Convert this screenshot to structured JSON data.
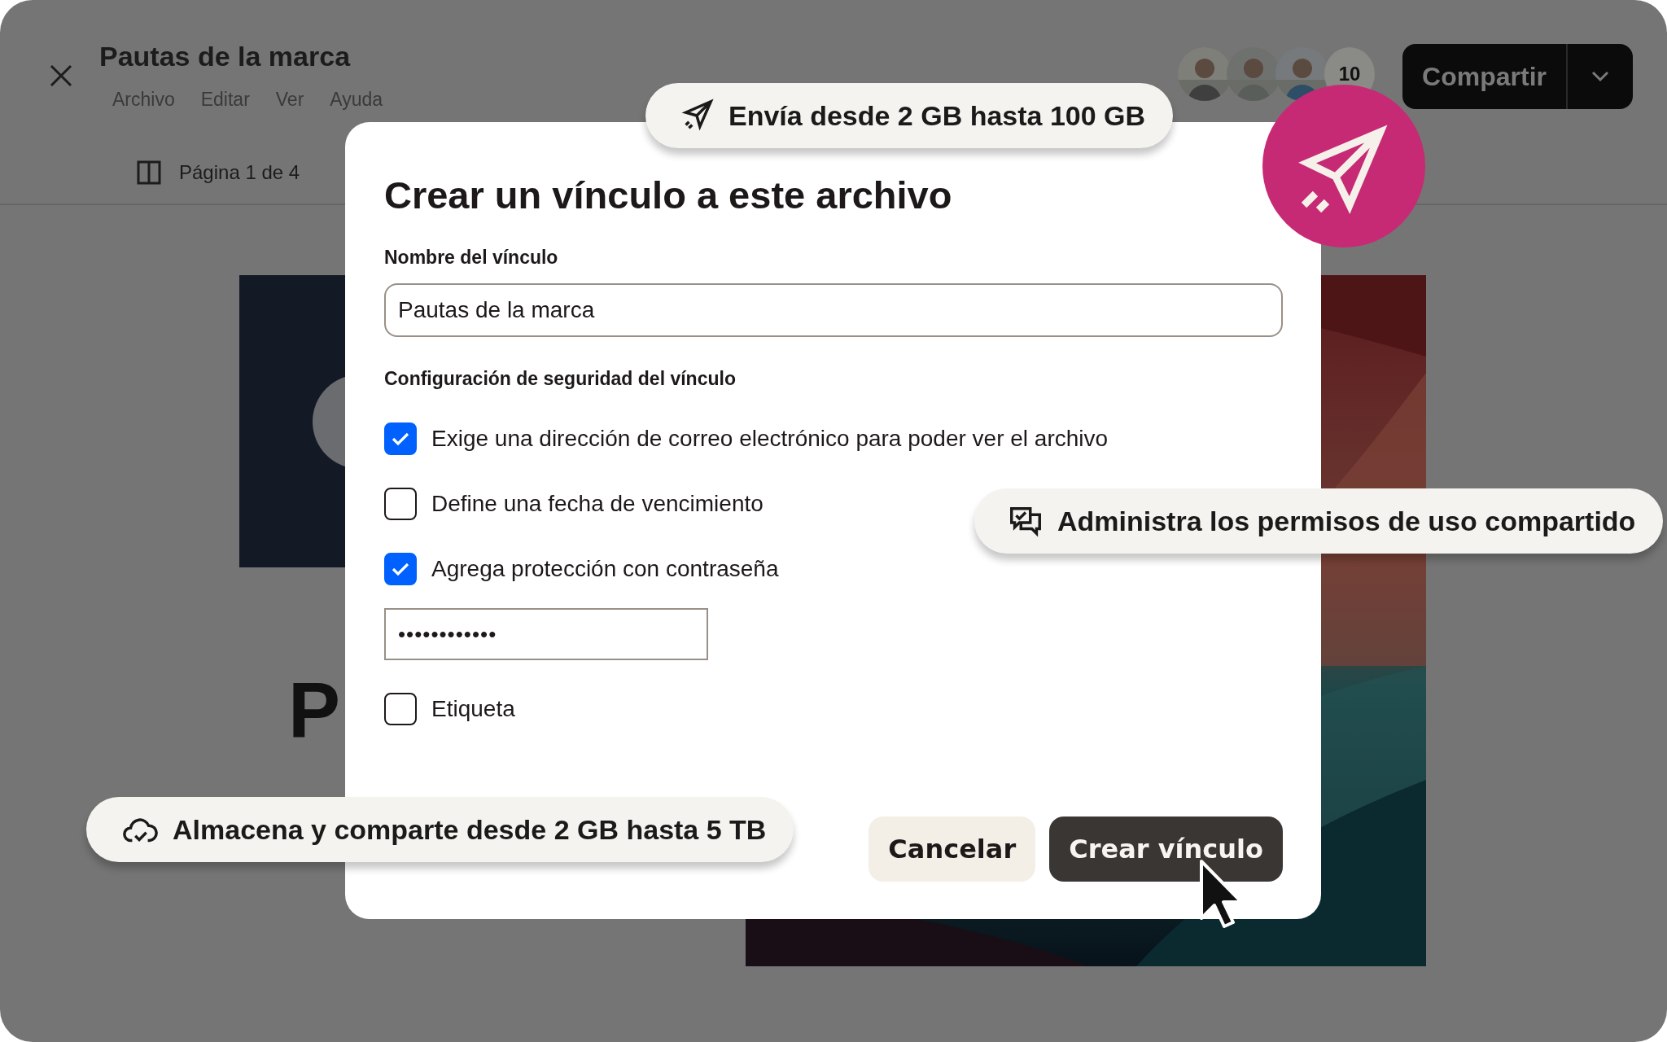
{
  "header": {
    "title": "Pautas de la marca",
    "menu": [
      "Archivo",
      "Editar",
      "Ver",
      "Ayuda"
    ],
    "page_indicator": "Página 1 de 4",
    "avatars": [
      {
        "kind": "picture"
      },
      {
        "kind": "picture"
      },
      {
        "kind": "picture"
      }
    ],
    "avatar_count": "10",
    "share_button": "Compartir"
  },
  "document": {
    "heading_lines": [
      "P"
    ]
  },
  "dialog": {
    "title": "Crear un vínculo a este archivo",
    "name_label": "Nombre del vínculo",
    "name_value": "Pautas de la marca",
    "security_label": "Configuración de seguridad del vínculo",
    "options": [
      {
        "kind": "checkbox",
        "label": "Exige una dirección de correo electrónico para poder ver el archivo",
        "checked": true
      },
      {
        "kind": "checkbox",
        "label": "Define una fecha de vencimiento",
        "checked": false
      },
      {
        "kind": "checkbox",
        "label": "Agrega protección con contraseña",
        "checked": true
      },
      {
        "kind": "password",
        "value": "••••••••••••"
      },
      {
        "kind": "checkbox",
        "label": "Etiqueta",
        "checked": false
      }
    ],
    "buttons": [
      {
        "kind": "secondary",
        "label": "Cancelar"
      },
      {
        "kind": "primary",
        "label": "Crear vínculo"
      }
    ]
  },
  "callouts": [
    {
      "kind": "send",
      "text": "Envía desde 2 GB hasta 100 GB"
    },
    {
      "kind": "permissions",
      "text": "Administra los permisos de uso compartido"
    },
    {
      "kind": "cloud",
      "text": "Almacena y comparte desde 2 GB hasta 5 TB"
    }
  ]
}
